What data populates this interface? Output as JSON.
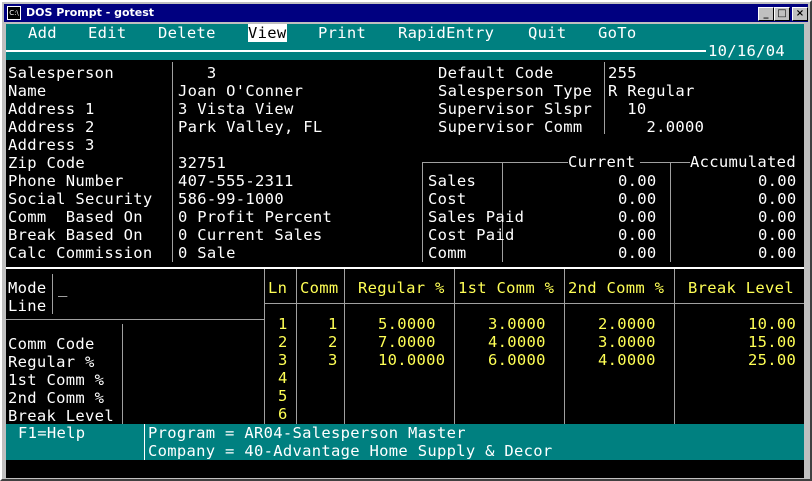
{
  "window": {
    "title": "DOS Prompt - gotest",
    "icon": "C:\\",
    "minimize": "_",
    "maximize": "□",
    "close": "×"
  },
  "menu": {
    "items": [
      "Add",
      "Edit",
      "Delete",
      "View",
      "Print",
      "RapidEntry",
      "Quit",
      "GoTo"
    ],
    "active": "View",
    "date": "10/16/04"
  },
  "left_fields": {
    "labels": [
      "Salesperson",
      "Name",
      "Address 1",
      "Address 2",
      "Address 3",
      "Zip Code",
      "Phone Number",
      "Social Security",
      "Comm  Based On",
      "Break Based On",
      "Calc Commission"
    ],
    "values": [
      "   3",
      "Joan O'Conner",
      "3 Vista View",
      "Park Valley, FL",
      "",
      "32751",
      "407-555-2311",
      "586-99-1000",
      "0 Profit Percent",
      "0 Current Sales",
      "0 Sale"
    ]
  },
  "right_fields": {
    "labels": [
      "Default Code",
      "Salesperson Type",
      "Supervisor Slspr",
      "Supervisor Comm"
    ],
    "values": [
      "255",
      "R Regular",
      "  10",
      "    2.0000"
    ]
  },
  "totals": {
    "col_current": "Current",
    "col_accumulated": "Accumulated",
    "rows": [
      {
        "label": "Sales",
        "current": "0.00",
        "accumulated": "0.00"
      },
      {
        "label": "Cost",
        "current": "0.00",
        "accumulated": "0.00"
      },
      {
        "label": "Sales Paid",
        "current": "0.00",
        "accumulated": "0.00"
      },
      {
        "label": "Cost Paid",
        "current": "0.00",
        "accumulated": "0.00"
      },
      {
        "label": "Comm",
        "current": "0.00",
        "accumulated": "0.00"
      }
    ]
  },
  "mode": {
    "mode_label": "Mode",
    "line_label": "Line",
    "cursor": "_"
  },
  "detail_labels": [
    "Comm Code",
    "Regular %",
    "1st Comm %",
    "2nd Comm %",
    "Break Level"
  ],
  "grid": {
    "headers": [
      "Ln",
      "Comm",
      "Regular %",
      "1st Comm %",
      "2nd Comm %",
      "Break Level"
    ],
    "rows": [
      {
        "ln": "1",
        "comm": "1",
        "regular": "5.0000",
        "first": "3.0000",
        "second": "2.0000",
        "brk": "10.00"
      },
      {
        "ln": "2",
        "comm": "2",
        "regular": "7.0000",
        "first": "4.0000",
        "second": "3.0000",
        "brk": "15.00"
      },
      {
        "ln": "3",
        "comm": "3",
        "regular": "10.0000",
        "first": "6.0000",
        "second": "4.0000",
        "brk": "25.00"
      },
      {
        "ln": "4",
        "comm": "",
        "regular": "",
        "first": "",
        "second": "",
        "brk": ""
      },
      {
        "ln": "5",
        "comm": "",
        "regular": "",
        "first": "",
        "second": "",
        "brk": ""
      },
      {
        "ln": "6",
        "comm": "",
        "regular": "",
        "first": "",
        "second": "",
        "brk": ""
      }
    ]
  },
  "footer": {
    "help": "F1=Help",
    "program": "Program = AR04-Salesperson Master",
    "company": "Company = 40-Advantage Home Supply & Decor"
  },
  "colors": {
    "titlebar": "#000080",
    "menu_bg": "#008080",
    "text": "#ffffff",
    "grid_text": "#ffff55",
    "console_bg": "#000000"
  }
}
